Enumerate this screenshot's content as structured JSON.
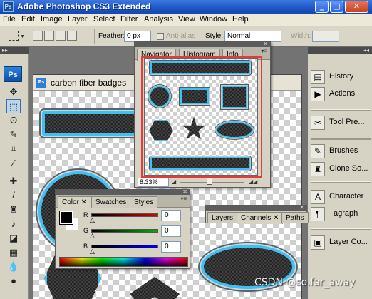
{
  "window": {
    "title": "Adobe Photoshop CS3 Extended",
    "app_icon": "Ps",
    "controls": [
      "minimize-icon",
      "maximize-icon",
      "close-icon"
    ],
    "accent": "#1d56c6"
  },
  "menu": [
    "File",
    "Edit",
    "Image",
    "Layer",
    "Select",
    "Filter",
    "Analysis",
    "View",
    "Window",
    "Help"
  ],
  "options": {
    "feather_label": "Feather:",
    "feather_value": "0 px",
    "antialias_label": "Anti-alias",
    "style_label": "Style:",
    "style_value": "Normal",
    "width_label": "Width:"
  },
  "tools": {
    "logo": "Ps",
    "items": [
      "move-tool",
      "marquee-tool",
      "lasso-tool",
      "quick-selection-tool",
      "crop-tool",
      "eyedropper-tool",
      "healing-brush-tool",
      "brush-tool",
      "clone-stamp-tool",
      "history-brush-tool",
      "eraser-tool",
      "gradient-tool",
      "blur-tool",
      "dodge-tool"
    ]
  },
  "document": {
    "icon": "Ps",
    "title": "carbon fiber badges"
  },
  "navigator": {
    "tabs": [
      "Navigator",
      "Histogram",
      "Info"
    ],
    "zoom": "8.33%",
    "zoom_slider_fraction": 0.45,
    "view_box_color": "#e23b3b"
  },
  "color_panel": {
    "tabs": [
      "Color",
      "Swatches",
      "Styles"
    ],
    "channels": [
      {
        "label": "R",
        "value": "0",
        "color": "#e00000"
      },
      {
        "label": "G",
        "value": "0",
        "color": "#00b000"
      },
      {
        "label": "B",
        "value": "0",
        "color": "#0000e0"
      }
    ],
    "foreground": "#000000",
    "background": "#ffffff"
  },
  "layers_panel": {
    "tabs": [
      "Layers",
      "Channels",
      "Paths"
    ]
  },
  "dock": [
    {
      "label": "History",
      "icon": "history-icon"
    },
    {
      "label": "Actions",
      "icon": "actions-icon"
    },
    {
      "label": "Tool Pre...",
      "icon": "tool-presets-icon"
    },
    {
      "label": "Brushes",
      "icon": "brushes-icon"
    },
    {
      "label": "Clone So...",
      "icon": "clone-source-icon"
    },
    {
      "label": "Character",
      "icon": "character-icon"
    },
    {
      "label": "agraph",
      "icon": "paragraph-icon"
    },
    {
      "label": "Layer Co...",
      "icon": "layer-comps-icon"
    }
  ],
  "watermark": "CSDN @so.far_away"
}
